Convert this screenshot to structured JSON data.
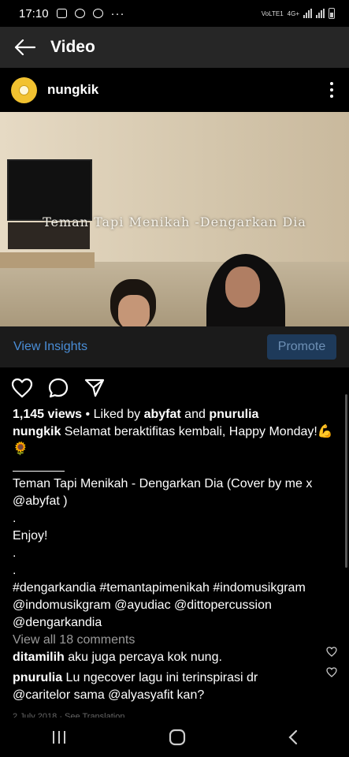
{
  "status_bar": {
    "time": "17:10",
    "icons": [
      "gallery-icon",
      "chat-icon",
      "sync-icon"
    ],
    "overflow": "···",
    "network_label_1": "VoLTE1",
    "network_label_2": "4G+"
  },
  "header": {
    "title": "Video"
  },
  "post": {
    "username": "nungkik",
    "video_overlay_text": "Teman Tapi Menikah -Dengarkan Dia",
    "view_insights": "View Insights",
    "promote": "Promote",
    "views": "1,145 views",
    "liked_by_prefix": " • Liked by ",
    "liked_user_1": "abyfat",
    "liked_and": " and ",
    "liked_user_2": "pnurulia",
    "caption_user": "nungkik",
    "caption_first": " Selamat beraktifitas kembali, Happy Monday!",
    "caption_emoji_1": "💪",
    "caption_emoji_2": "🌻",
    "caption_song_1": "Teman Tapi Menikah - Dengarkan Dia (Cover by me x",
    "caption_song_2": "@abyfat )",
    "dot_1": ".",
    "enjoy": "Enjoy!",
    "dot_2": ".",
    "dot_3": ".",
    "hashtags_1": "#dengarkandia #temantapimenikah #indomusikgram",
    "hashtags_2": "@indomusikgram @ayudiac @dittopercussion",
    "hashtags_3": "@dengarkandia",
    "view_all_comments": "View all 18 comments",
    "comments": [
      {
        "user": "ditamilih",
        "text": " aku juga percaya kok nung."
      },
      {
        "user": "pnurulia",
        "text": " Lu ngecover lagu ini terinspirasi dr",
        "text2": "@caritelor sama @alyasyafit kan?"
      }
    ],
    "timestamp_partial": "2 July 2018 · See Translation"
  },
  "colors": {
    "accent_link": "#4a8ed8",
    "promote_bg": "#1e3a5a",
    "header_bg": "#262626"
  }
}
